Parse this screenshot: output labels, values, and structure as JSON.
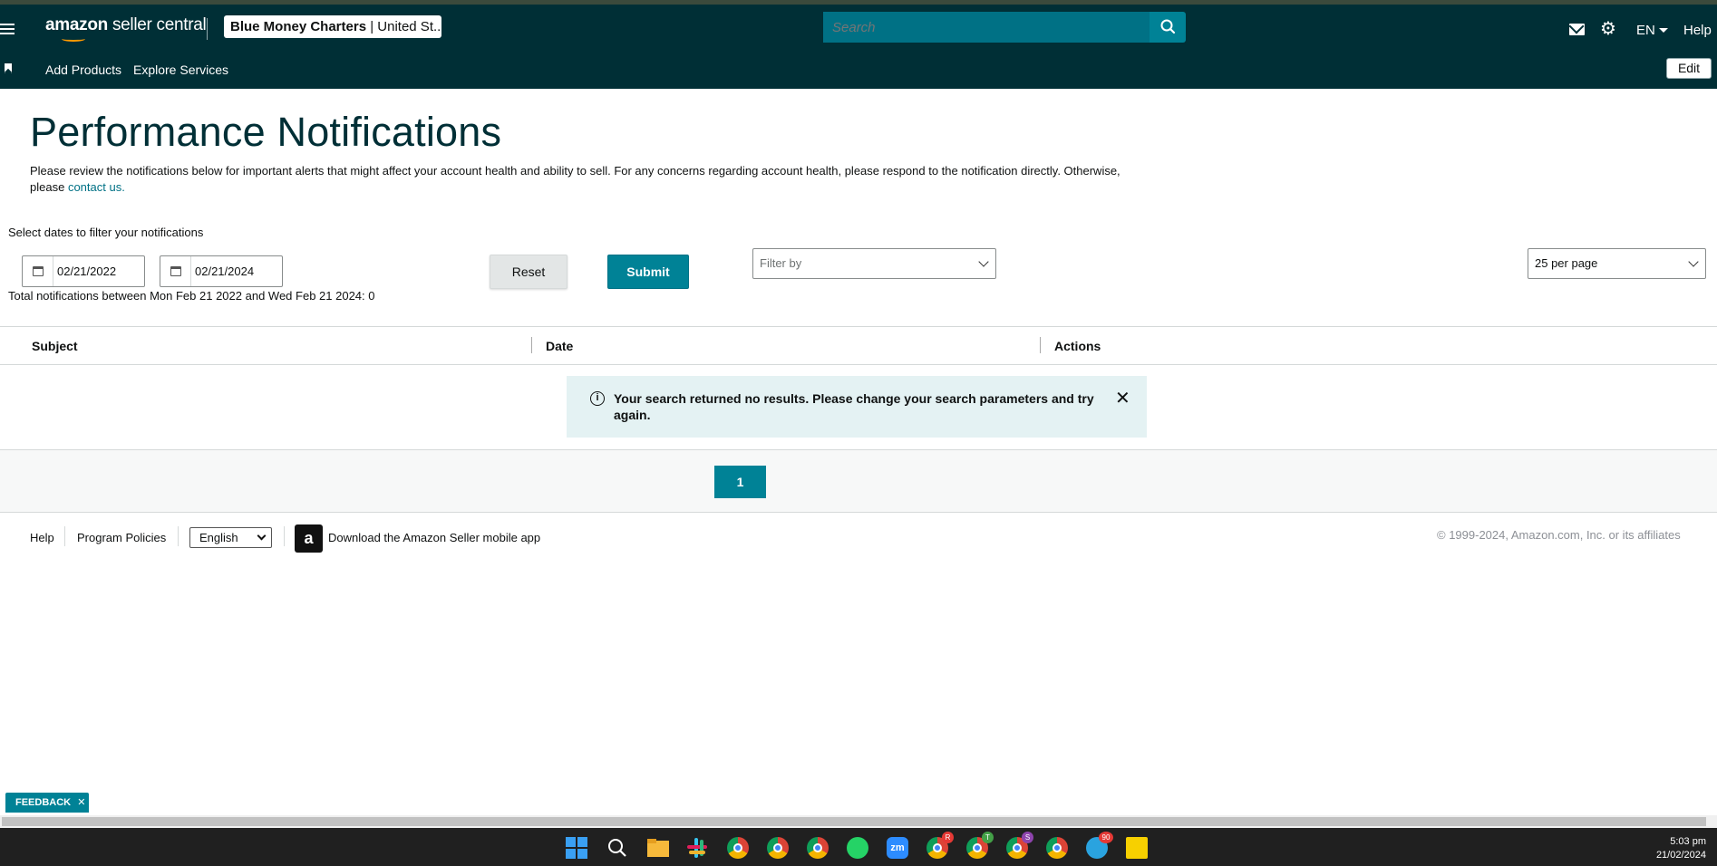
{
  "header": {
    "logo_text_bold": "amazon",
    "logo_text": "seller central",
    "account_name": "Blue Money Charters",
    "account_region": "| United St...",
    "search_placeholder": "Search",
    "language": "EN",
    "help": "Help"
  },
  "nav": {
    "items": [
      {
        "label": "Add Products"
      },
      {
        "label": "Explore Services"
      }
    ],
    "edit_label": "Edit"
  },
  "page": {
    "title": "Performance Notifications",
    "intro_text": "Please review the notifications below for important alerts that might affect your account health and ability to sell. For any concerns regarding account health, please respond to the notification directly. Otherwise, please",
    "contact_link": "contact us."
  },
  "filters": {
    "label": "Select dates to filter your notifications",
    "start_date": "02/21/2022",
    "end_date": "02/21/2024",
    "reset_label": "Reset",
    "submit_label": "Submit",
    "filter_by_placeholder": "Filter by",
    "per_page": "25 per page",
    "total_text": "Total notifications between Mon Feb 21 2022 and Wed Feb 21 2024: 0"
  },
  "table": {
    "columns": [
      "Subject",
      "Date",
      "Actions"
    ],
    "no_results": "Your search returned no results. Please change your search parameters and try again."
  },
  "pagination": {
    "current_page": "1"
  },
  "footer": {
    "help": "Help",
    "policies": "Program Policies",
    "language": "English",
    "app_link": "Download the Amazon Seller mobile app",
    "copyright": "© 1999-2024, Amazon.com, Inc. or its affiliates"
  },
  "feedback": {
    "label": "FEEDBACK",
    "close": "✕"
  },
  "taskbar": {
    "time": "5:03 pm",
    "date": "21/02/2024",
    "badges": [
      "R",
      "T",
      "S",
      "90"
    ]
  },
  "colors": {
    "header_bg": "#002f36",
    "accent": "#008296",
    "link": "#007185",
    "info_bg": "#e4f2f3"
  }
}
